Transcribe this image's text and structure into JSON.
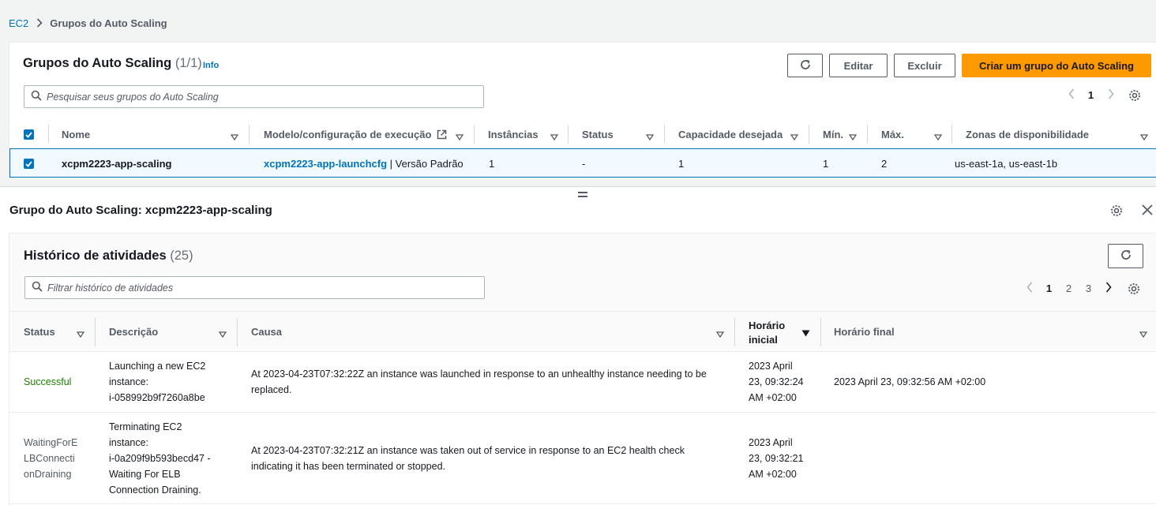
{
  "breadcrumb": {
    "root": "EC2",
    "current": "Grupos do Auto Scaling"
  },
  "groups_panel": {
    "title": "Grupos do Auto Scaling",
    "count": "(1/1)",
    "info": "Info",
    "refresh_icon": "refresh-icon",
    "edit_label": "Editar",
    "delete_label": "Excluir",
    "create_label": "Criar um grupo do Auto Scaling",
    "search_placeholder": "Pesquisar seus grupos do Auto Scaling",
    "page": "1",
    "columns": {
      "name": "Nome",
      "launch": "Modelo/configuração de execução",
      "instances": "Instâncias",
      "status": "Status",
      "desired": "Capacidade desejada",
      "min": "Mín.",
      "max": "Máx.",
      "zones": "Zonas de disponibilidade"
    },
    "row": {
      "name": "xcpm2223-app-scaling",
      "launch": "xcpm2223-app-launchcfg",
      "launch_suffix": "| Versão Padrão",
      "instances": "1",
      "status": "-",
      "desired": "1",
      "min": "1",
      "max": "2",
      "zones": "us-east-1a, us-east-1b"
    }
  },
  "detail": {
    "title": "Grupo do Auto Scaling: xcpm2223-app-scaling"
  },
  "history": {
    "title": "Histórico de atividades",
    "count": "(25)",
    "search_placeholder": "Filtrar histórico de atividades",
    "pages": [
      "1",
      "2",
      "3"
    ],
    "columns": {
      "status": "Status",
      "description": "Descrição",
      "cause": "Causa",
      "start_line1": "Horário",
      "start_line2": "inicial",
      "end": "Horário final"
    },
    "rows": [
      {
        "status": "Successful",
        "desc": [
          "Launching a new EC2",
          "instance:",
          "i-058992b9f7260a8be"
        ],
        "cause": [
          "At 2023-04-23T07:32:22Z an instance was launched in response to an unhealthy instance needing to be",
          "replaced."
        ],
        "start": [
          "2023 April",
          "23, 09:32:24",
          "AM +02:00"
        ],
        "end": "2023 April 23, 09:32:56 AM +02:00"
      },
      {
        "status": [
          "WaitingForE",
          "LBConnecti",
          "onDraining"
        ],
        "desc": [
          "Terminating EC2",
          "instance:",
          "i-0a209f9b593becd47 -",
          "Waiting For ELB",
          "Connection Draining."
        ],
        "cause": [
          "At 2023-04-23T07:32:21Z an instance was taken out of service in response to an EC2 health check",
          "indicating it has been terminated or stopped."
        ],
        "start": [
          "2023 April",
          "23, 09:32:21",
          "AM +02:00"
        ],
        "end": ""
      }
    ]
  },
  "colors": {
    "link": "#0073bb",
    "primary": "#ff9900",
    "success": "#1d8102"
  }
}
